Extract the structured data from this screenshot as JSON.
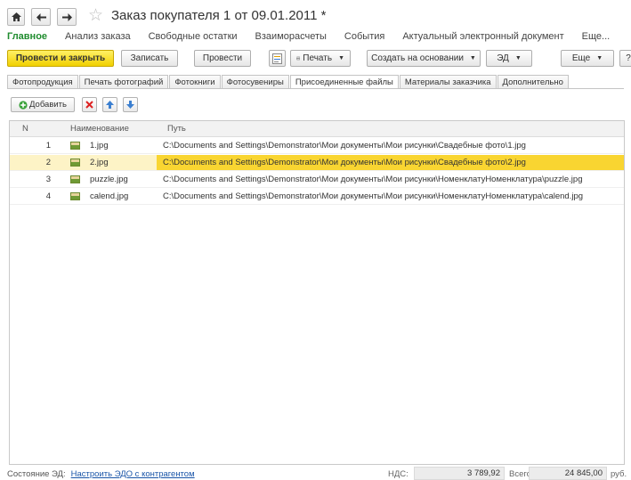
{
  "header": {
    "title": "Заказ покупателя 1 от 09.01.2011 *"
  },
  "sections": [
    {
      "label": "Главное"
    },
    {
      "label": "Анализ заказа"
    },
    {
      "label": "Свободные остатки"
    },
    {
      "label": "Взаиморасчеты"
    },
    {
      "label": "События"
    },
    {
      "label": "Актуальный электронный документ"
    },
    {
      "label": "Еще..."
    }
  ],
  "toolbar": {
    "post_close": "Провести и закрыть",
    "save": "Записать",
    "post": "Провести",
    "print": "Печать",
    "create_based": "Создать на основании",
    "ed": "ЭД",
    "more": "Еще",
    "help": "?"
  },
  "tabs": [
    {
      "label": "Фотопродукция"
    },
    {
      "label": "Печать фотографий"
    },
    {
      "label": "Фотокниги"
    },
    {
      "label": "Фотосувениры"
    },
    {
      "label": "Присоединенные файлы"
    },
    {
      "label": "Материалы заказчика"
    },
    {
      "label": "Дополнительно"
    }
  ],
  "files_toolbar": {
    "add": "Добавить"
  },
  "table": {
    "columns": [
      "N",
      "Наименование",
      "Путь"
    ],
    "rows": [
      {
        "n": "1",
        "name": "1.jpg",
        "path": "C:\\Documents and Settings\\Demonstrator\\Мои документы\\Мои рисунки\\Свадебные фото\\1.jpg"
      },
      {
        "n": "2",
        "name": "2.jpg",
        "path": "C:\\Documents and Settings\\Demonstrator\\Мои документы\\Мои рисунки\\Свадебные фото\\2.jpg"
      },
      {
        "n": "3",
        "name": "puzzle.jpg",
        "path": "C:\\Documents and Settings\\Demonstrator\\Мои документы\\Мои рисунки\\НоменклатуНоменклатура\\puzzle.jpg"
      },
      {
        "n": "4",
        "name": "calend.jpg",
        "path": "C:\\Documents and Settings\\Demonstrator\\Мои документы\\Мои рисунки\\НоменклатуНоменклатура\\calend.jpg"
      }
    ],
    "selected_row": 2
  },
  "status": {
    "ed_label": "Состояние ЭД:",
    "ed_link": "Настроить ЭДО с контрагентом",
    "vat_label": "НДС:",
    "vat_value": "3 789,92",
    "total_label": "Всего:",
    "total_value": "24 845,00",
    "currency": "руб."
  },
  "colors": {
    "accent_green": "#1f8c2e",
    "primary_button": "#f1d000",
    "selected_cell": "#f9d531",
    "selected_row": "#fdf3c6",
    "link": "#1a55a8"
  }
}
